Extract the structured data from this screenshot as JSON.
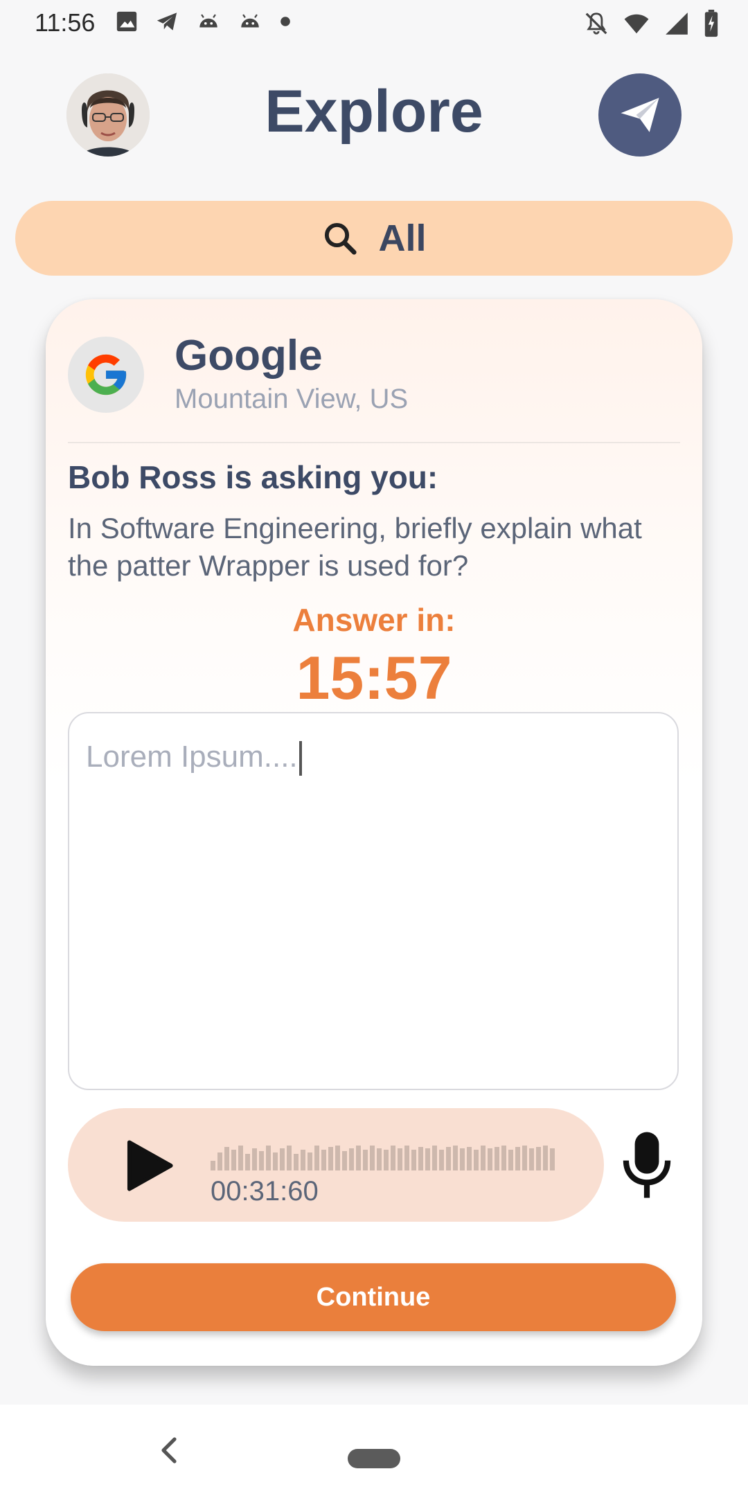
{
  "status_bar": {
    "time": "11:56",
    "left_icons": [
      "image-icon",
      "telegram-icon",
      "android-icon",
      "android-icon",
      "dot-icon"
    ],
    "right_icons": [
      "bell-off-icon",
      "wifi-icon",
      "signal-icon",
      "battery-charging-icon"
    ]
  },
  "header": {
    "title": "Explore",
    "avatar": "user-avatar",
    "action_icon": "send-icon"
  },
  "filter": {
    "icon": "search-icon",
    "label": "All"
  },
  "card": {
    "company": {
      "logo": "google-logo",
      "name": "Google",
      "location": "Mountain View, US"
    },
    "asker": "Bob Ross is asking you:",
    "question": "In Software Engineering, briefly explain what the patter Wrapper is used for?",
    "answer_in_label": "Answer in:",
    "timer": "15:57",
    "answer_field": {
      "value": "Lorem Ipsum....",
      "placeholder": ""
    },
    "audio": {
      "play_icon": "play-icon",
      "time": "00:31:60",
      "mic_icon": "microphone-icon"
    },
    "continue_label": "Continue"
  },
  "colors": {
    "accent": "#ea7f3c",
    "title": "#3d4a66",
    "filter_bg": "#fdd5b1",
    "audio_bg": "#f9dfd2",
    "send_button": "#4f5b80"
  },
  "nav_bar": {
    "back_icon": "back-chevron-icon",
    "home_icon": "home-pill-icon"
  }
}
